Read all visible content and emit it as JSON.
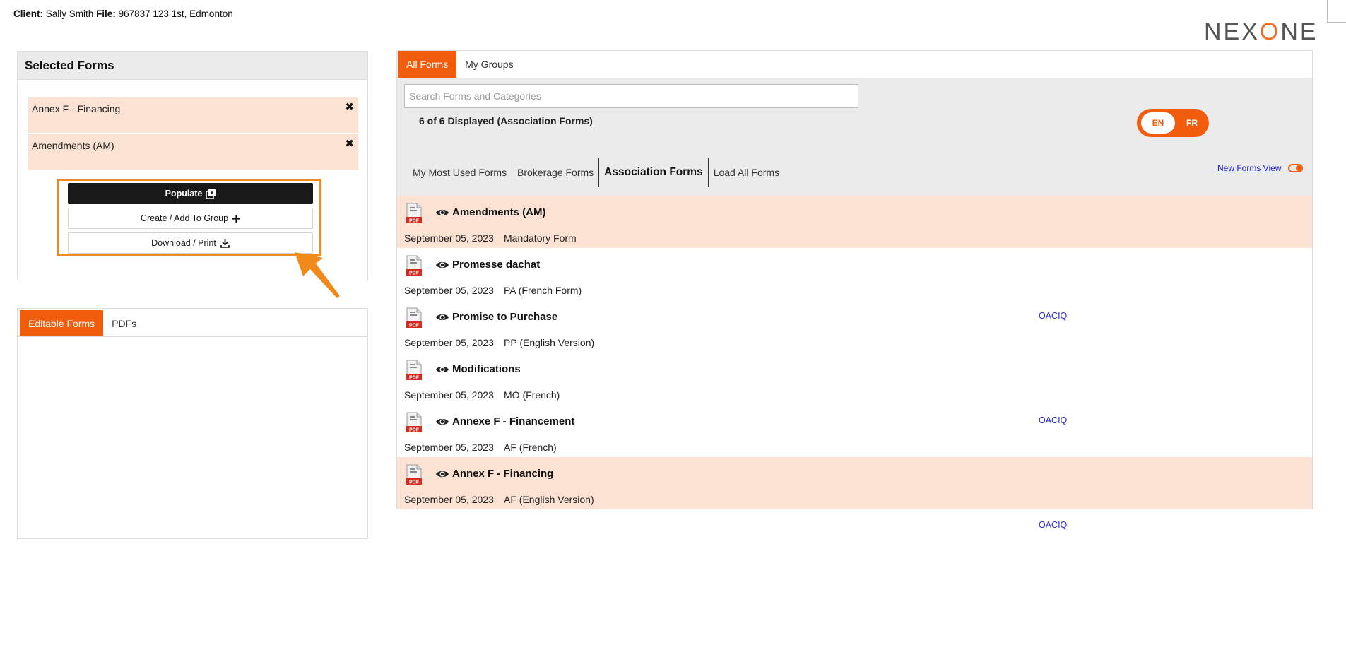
{
  "header": {
    "client_label": "Client:",
    "client_name": "Sally Smith",
    "file_label": "File:",
    "file_value": "967837 123 1st, Edmonton",
    "logo_left": "NEX",
    "logo_o": "O",
    "logo_right": "NE"
  },
  "selected": {
    "title": "Selected Forms",
    "items": [
      {
        "label": "Annex F - Financing"
      },
      {
        "label": "Amendments (AM)"
      }
    ],
    "remove_glyph": "✖",
    "actions": {
      "populate": "Populate",
      "create_group": "Create / Add To Group",
      "download_print": "Download / Print"
    }
  },
  "editable_panel": {
    "tabs": [
      "Editable Forms",
      "PDFs"
    ]
  },
  "forms_panel": {
    "tabs": [
      "All Forms",
      "My Groups"
    ],
    "search_placeholder": "Search Forms and Categories",
    "count_text": "6 of 6 Displayed (Association Forms)",
    "lang": {
      "en": "EN",
      "fr": "FR"
    },
    "categories": [
      "My Most Used Forms",
      "Brokerage Forms",
      "Association Forms",
      "Load All Forms"
    ],
    "active_category": "Association Forms",
    "new_forms_view": "New Forms View",
    "forms": [
      {
        "title": "Amendments (AM)",
        "date": "September 05, 2023",
        "code": "Mandatory Form",
        "highlight": true,
        "tag": ""
      },
      {
        "title": "Promesse dachat",
        "date": "September 05, 2023",
        "code": "PA (French Form)",
        "highlight": false,
        "tag": "OACIQ"
      },
      {
        "title": "Promise to Purchase",
        "date": "September 05, 2023",
        "code": "PP (English Version)",
        "highlight": false,
        "tag": ""
      },
      {
        "title": "Modifications",
        "date": "September 05, 2023",
        "code": "MO (French)",
        "highlight": false,
        "tag": "OACIQ"
      },
      {
        "title": "Annexe F - Financement",
        "date": "September 05, 2023",
        "code": "AF (French)",
        "highlight": false,
        "tag": ""
      },
      {
        "title": "Annex F - Financing",
        "date": "September 05, 2023",
        "code": "AF (English Version)",
        "highlight": true,
        "tag": "OACIQ"
      }
    ]
  },
  "colors": {
    "accent": "#f25c0d",
    "highlight_row": "#fbe2d3",
    "callout_border": "#f28a1b",
    "link": "#2a2ae0"
  }
}
